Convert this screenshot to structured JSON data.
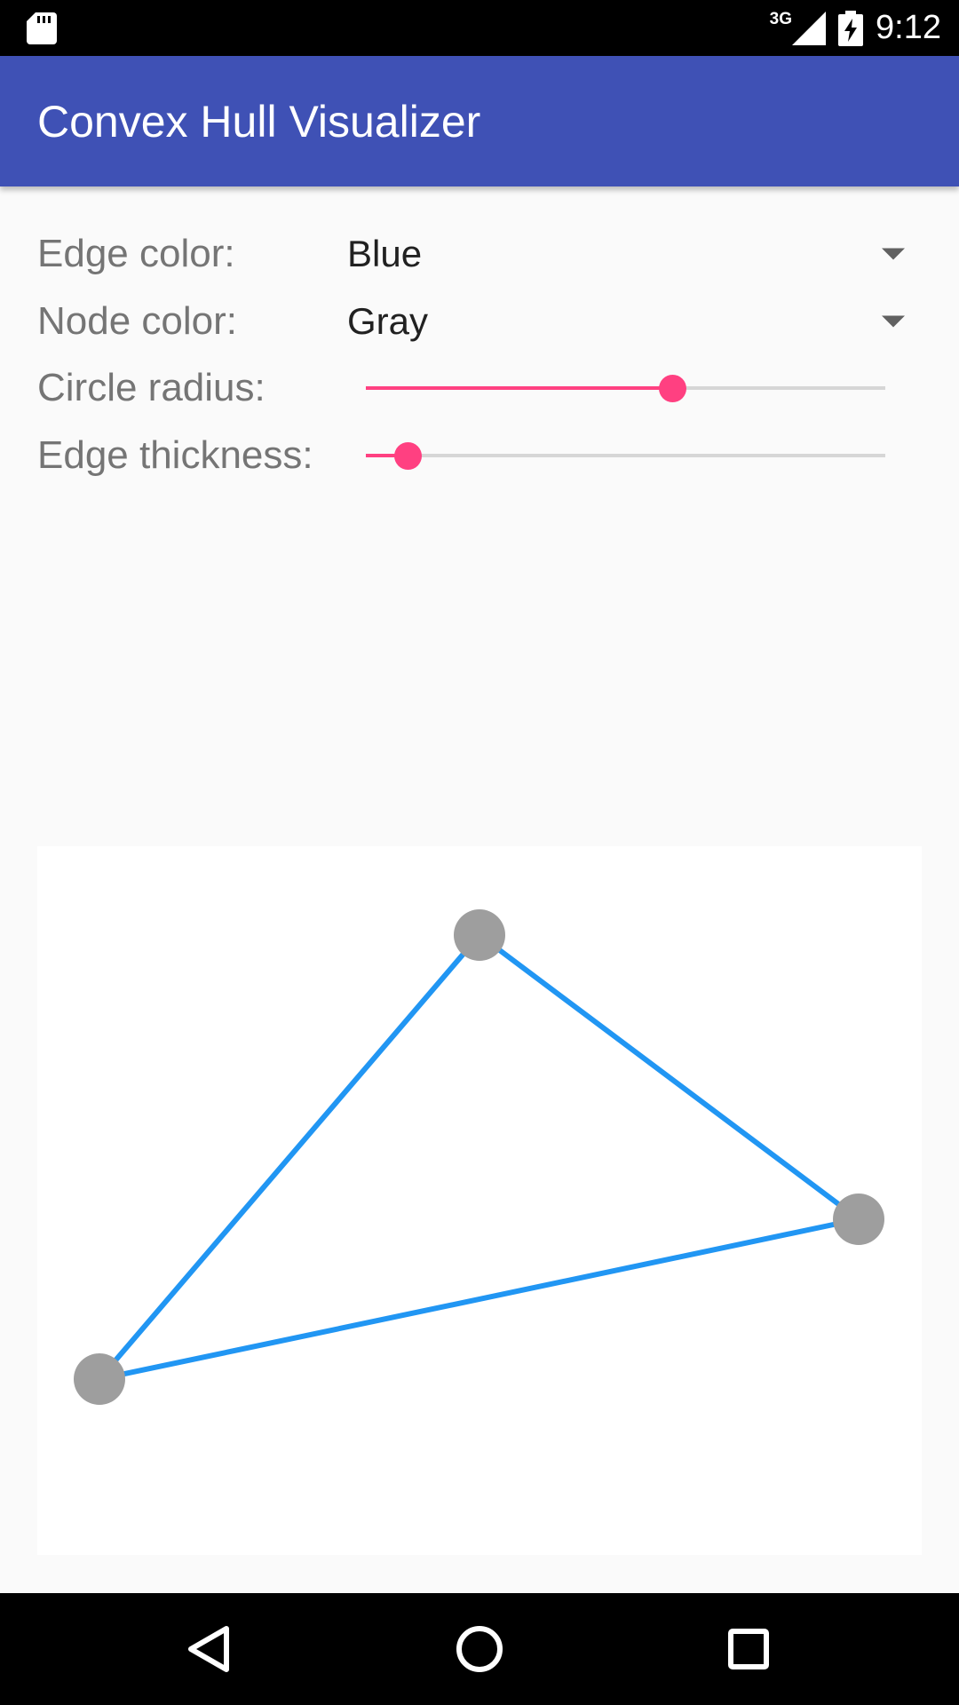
{
  "status_bar": {
    "time": "9:12",
    "network": "3G",
    "icons": [
      "sd-card-icon",
      "signal-icon",
      "battery-charging-icon"
    ]
  },
  "app_bar": {
    "title": "Convex Hull Visualizer",
    "color": "#3F51B5"
  },
  "controls": {
    "edge_color": {
      "label": "Edge color:",
      "value": "Blue"
    },
    "node_color": {
      "label": "Node color:",
      "value": "Gray"
    },
    "circle_radius": {
      "label": "Circle radius:",
      "value": 0.59
    },
    "edge_thickness": {
      "label": "Edge thickness:",
      "value": 0.08
    }
  },
  "canvas": {
    "edge_color": "#2196F3",
    "node_color": "#9E9E9E",
    "nodes": [
      {
        "name": "top"
      },
      {
        "name": "right"
      },
      {
        "name": "bottom-left"
      }
    ]
  },
  "nav_bar": {
    "icons": [
      "back-icon",
      "home-icon",
      "recents-icon"
    ]
  },
  "colors": {
    "accent": "#FF4081",
    "primary": "#3F51B5"
  }
}
